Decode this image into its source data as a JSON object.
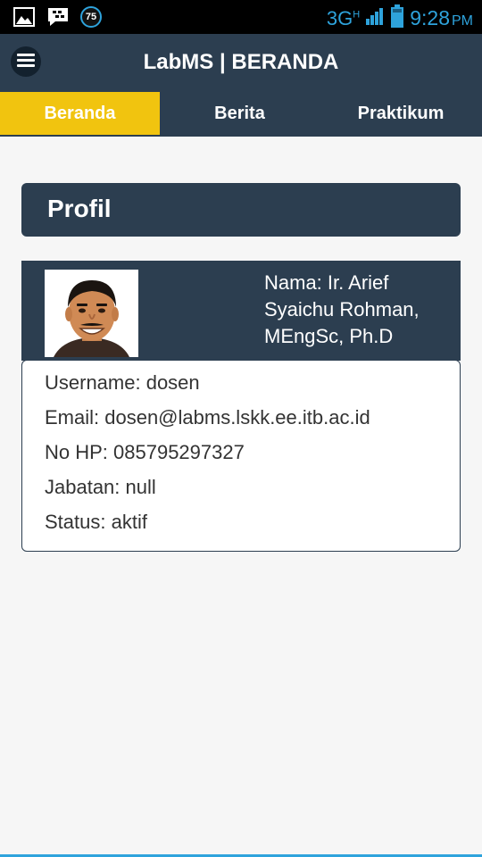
{
  "status_bar": {
    "notification_count": "75",
    "network": "3G",
    "network_sub": "H",
    "time": "9:28",
    "ampm": "PM"
  },
  "app_bar": {
    "title": "LabMS | BERANDA"
  },
  "tabs": [
    {
      "label": "Beranda",
      "active": true
    },
    {
      "label": "Berita",
      "active": false
    },
    {
      "label": "Praktikum",
      "active": false
    }
  ],
  "profile": {
    "section_title": "Profil",
    "name_line": "Nama: Ir. Arief Syaichu Rohman, MEngSc, Ph.D",
    "details": {
      "username": "Username: dosen",
      "email": "Email: dosen@labms.lskk.ee.itb.ac.id",
      "phone": "No HP: 085795297327",
      "jabatan": "Jabatan: null",
      "status": "Status: aktif"
    }
  },
  "colors": {
    "primary": "#2c3e50",
    "accent": "#f1c40f",
    "status_blue": "#2ea3dc",
    "background": "#f6f6f6"
  }
}
